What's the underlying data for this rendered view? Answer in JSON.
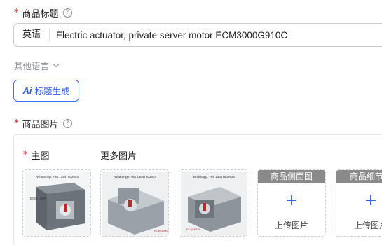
{
  "title_field": {
    "required_mark": "*",
    "label": "商品标题",
    "help_icon": "question-circle-icon",
    "language_tag": "英语",
    "value": "Electric actuator, private server motor ECM3000G910C"
  },
  "other_languages": {
    "label": "其他语言",
    "icon": "chevron-down-icon"
  },
  "ai_button": {
    "icon_text": "Ai",
    "label": "标题生成"
  },
  "images_field": {
    "required_mark": "*",
    "label": "商品图片",
    "help_icon": "question-circle-icon",
    "main_label": "主图",
    "more_label": "更多图片",
    "thumbnails": [
      {
        "watermark": "WhatsApp: +86 13647502644",
        "caption": "ECM...系列"
      },
      {
        "watermark": "WhatsApp: +86 13647502644",
        "caption": "ECM 3000"
      },
      {
        "watermark": "WhatsApp: +86 13647502644",
        "caption": "ECM 3000"
      }
    ],
    "slots": [
      {
        "title": "商品侧面图",
        "plus": "+",
        "upload_label": "上传图片"
      },
      {
        "title": "商品细节图",
        "plus": "+",
        "upload_label": "上传图片"
      }
    ]
  },
  "colors": {
    "accent": "#2f5fe8",
    "required": "#e02020",
    "slot_header": "#8a8a8a"
  }
}
